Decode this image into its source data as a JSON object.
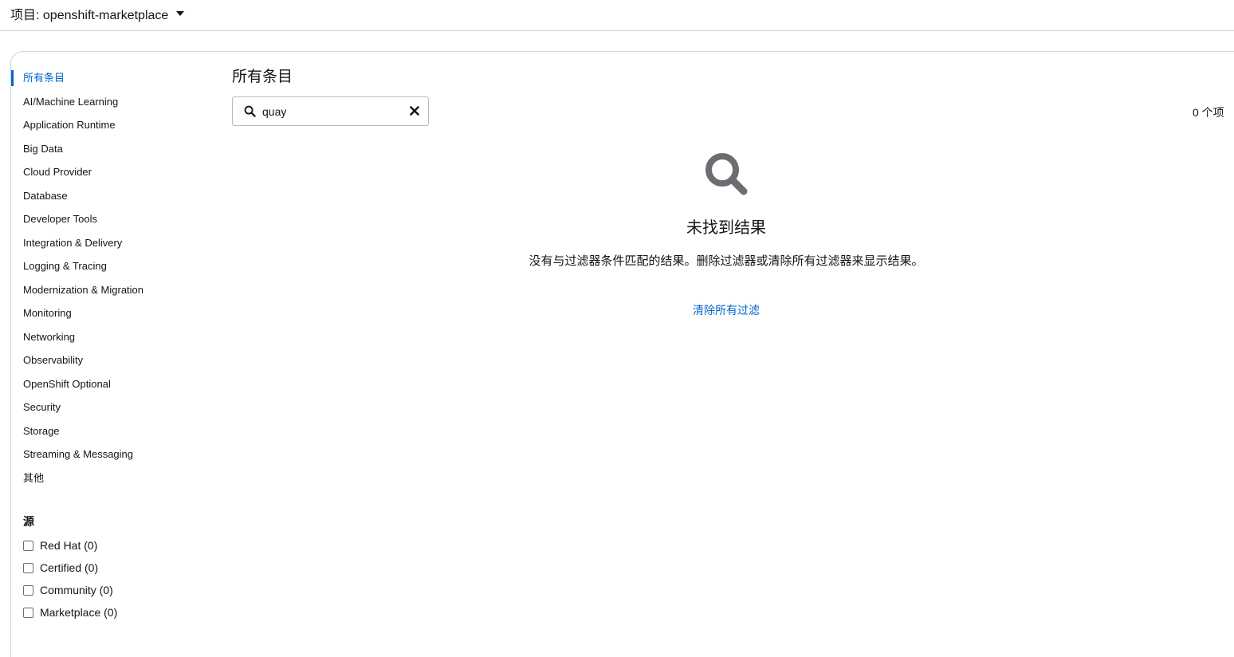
{
  "project": {
    "label": "项目: openshift-marketplace"
  },
  "sidebar": {
    "categories": [
      {
        "label": "所有条目",
        "active": true
      },
      {
        "label": "AI/Machine Learning"
      },
      {
        "label": "Application Runtime"
      },
      {
        "label": "Big Data"
      },
      {
        "label": "Cloud Provider"
      },
      {
        "label": "Database"
      },
      {
        "label": "Developer Tools"
      },
      {
        "label": "Integration & Delivery"
      },
      {
        "label": "Logging & Tracing"
      },
      {
        "label": "Modernization & Migration"
      },
      {
        "label": "Monitoring"
      },
      {
        "label": "Networking"
      },
      {
        "label": "Observability"
      },
      {
        "label": "OpenShift Optional"
      },
      {
        "label": "Security"
      },
      {
        "label": "Storage"
      },
      {
        "label": "Streaming & Messaging"
      },
      {
        "label": "其他"
      }
    ],
    "source_heading": "源",
    "sources": [
      {
        "label": "Red Hat (0)"
      },
      {
        "label": "Certified (0)"
      },
      {
        "label": "Community (0)"
      },
      {
        "label": "Marketplace (0)"
      }
    ]
  },
  "main": {
    "title": "所有条目",
    "search": {
      "value": "quay"
    },
    "count": "0 个项"
  },
  "empty_state": {
    "title": "未找到结果",
    "body": "没有与过滤器条件匹配的结果。删除过滤器或清除所有过滤器来显示结果。",
    "clear_link": "清除所有过滤"
  },
  "colors": {
    "accent": "#0066cc",
    "icon_gray": "#6a6e73",
    "border": "#d2d2d2"
  }
}
